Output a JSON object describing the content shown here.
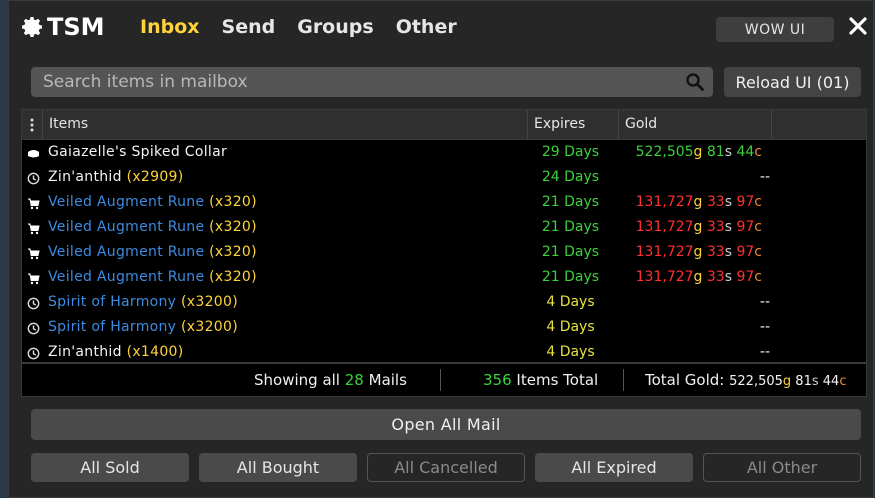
{
  "header": {
    "logo_text": "TSM",
    "tabs": [
      {
        "label": "Inbox",
        "active": true
      },
      {
        "label": "Send",
        "active": false
      },
      {
        "label": "Groups",
        "active": false
      },
      {
        "label": "Other",
        "active": false
      }
    ],
    "wow_button": "WOW UI",
    "close_icon": "close-icon"
  },
  "search": {
    "placeholder": "Search items in mailbox",
    "icon": "search-icon"
  },
  "reload_button": "Reload UI (01)",
  "table": {
    "columns": [
      "Items",
      "Expires",
      "Gold"
    ],
    "rows": [
      {
        "icon": "mail-icon",
        "name": "Gaiazelle's Spiked Collar",
        "qty": "",
        "name_color": "white",
        "expires": "29 Days",
        "exp_color": "green",
        "gold": {
          "g": "522,505",
          "s": "81",
          "c": "44",
          "color": "green"
        }
      },
      {
        "icon": "clock-icon",
        "name": "Zin'anthid",
        "qty": "(x2909)",
        "name_color": "white",
        "expires": "24 Days",
        "exp_color": "green",
        "gold": {
          "text": "--"
        }
      },
      {
        "icon": "cart-icon",
        "name": "Veiled Augment Rune",
        "qty": "(x320)",
        "name_color": "blue",
        "expires": "21 Days",
        "exp_color": "green",
        "gold": {
          "g": "131,727",
          "s": "33",
          "c": "97",
          "color": "red"
        }
      },
      {
        "icon": "cart-icon",
        "name": "Veiled Augment Rune",
        "qty": "(x320)",
        "name_color": "blue",
        "expires": "21 Days",
        "exp_color": "green",
        "gold": {
          "g": "131,727",
          "s": "33",
          "c": "97",
          "color": "red"
        }
      },
      {
        "icon": "cart-icon",
        "name": "Veiled Augment Rune",
        "qty": "(x320)",
        "name_color": "blue",
        "expires": "21 Days",
        "exp_color": "green",
        "gold": {
          "g": "131,727",
          "s": "33",
          "c": "97",
          "color": "red"
        }
      },
      {
        "icon": "cart-icon",
        "name": "Veiled Augment Rune",
        "qty": "(x320)",
        "name_color": "blue",
        "expires": "21 Days",
        "exp_color": "green",
        "gold": {
          "g": "131,727",
          "s": "33",
          "c": "97",
          "color": "red"
        }
      },
      {
        "icon": "clock-icon",
        "name": "Spirit of Harmony",
        "qty": "(x3200)",
        "name_color": "blue",
        "expires": "4 Days",
        "exp_color": "yellow",
        "gold": {
          "text": "--"
        }
      },
      {
        "icon": "clock-icon",
        "name": "Spirit of Harmony",
        "qty": "(x3200)",
        "name_color": "blue",
        "expires": "4 Days",
        "exp_color": "yellow",
        "gold": {
          "text": "--"
        }
      },
      {
        "icon": "clock-icon",
        "name": "Zin'anthid",
        "qty": "(x1400)",
        "name_color": "white",
        "expires": "4 Days",
        "exp_color": "yellow",
        "gold": {
          "text": "--"
        }
      }
    ]
  },
  "footer": {
    "showing_prefix": "Showing all",
    "showing_count": "28",
    "showing_suffix": "Mails",
    "items_count": "356",
    "items_suffix": "Items Total",
    "total_label": "Total Gold:",
    "total_g": "522,505",
    "total_s": "81",
    "total_c": "44"
  },
  "open_all": "Open All Mail",
  "filters": [
    {
      "label": "All Sold",
      "enabled": true
    },
    {
      "label": "All Bought",
      "enabled": true
    },
    {
      "label": "All Cancelled",
      "enabled": false
    },
    {
      "label": "All Expired",
      "enabled": true
    },
    {
      "label": "All Other",
      "enabled": false
    }
  ],
  "colors": {
    "accent": "#ffd33a",
    "item_blue": "#3d8be0",
    "green": "#3cd03c",
    "red": "#ff3030",
    "panel": "#262626"
  }
}
